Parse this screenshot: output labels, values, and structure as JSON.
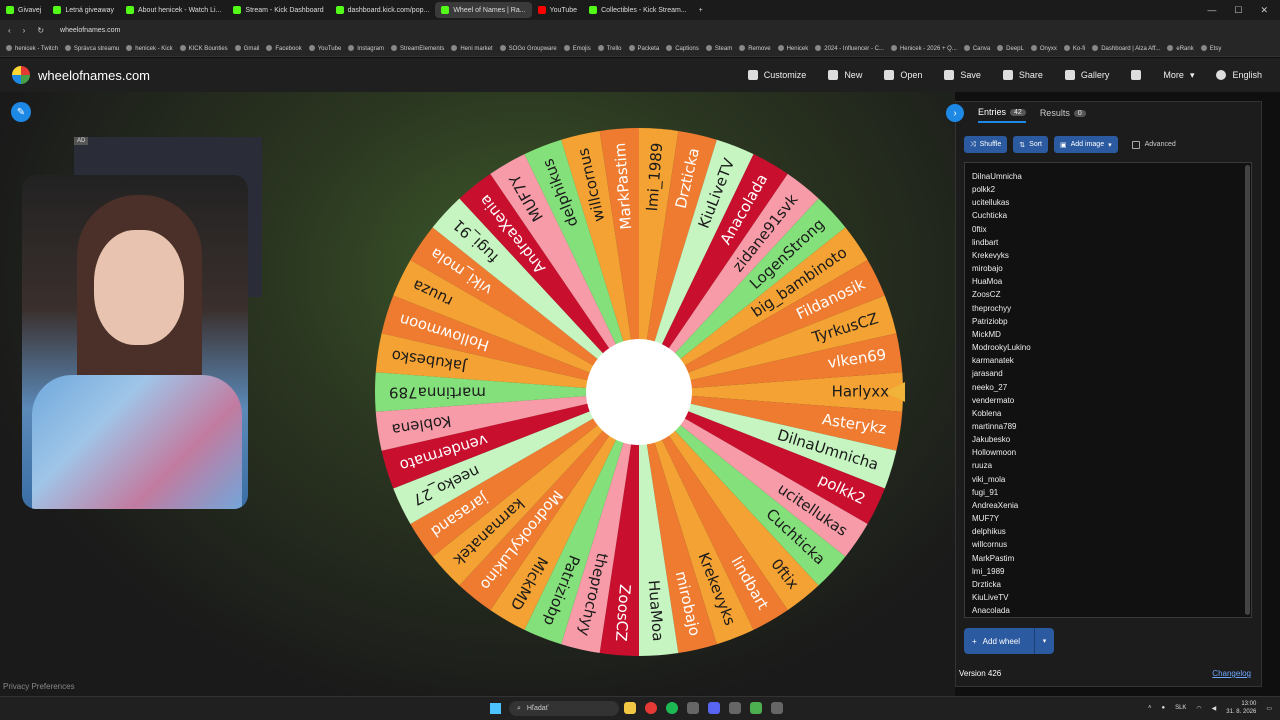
{
  "browser": {
    "tabs": [
      "Givavej",
      "Letná giveaway",
      "About henicek - Watch Li...",
      "Stream - Kick Dashboard",
      "dashboard.kick.com/pop...",
      "Wheel of Names | Ra...",
      "YouTube",
      "Collectibles - Kick Stream..."
    ],
    "url": "wheelofnames.com",
    "bookmarks": [
      "henicek - Twitch",
      "Správca streamu",
      "henicek - Kick",
      "KICK Bounties",
      "Gmail",
      "Facebook",
      "YouTube",
      "Instagram",
      "StreamElements",
      "Heni market",
      "SOGo Groupware",
      "Emojis",
      "Trello",
      "Packeta",
      "Captions",
      "Steam",
      "Remove",
      "Henicek",
      "2024 - Influencer - C...",
      "Henicek - 2026 + Q...",
      "Canva",
      "DeepL",
      "Onyxx",
      "Ko-fi",
      "Dashboard | Alza Aff...",
      "eRank",
      "Etsy"
    ]
  },
  "app": {
    "title": "wheelofnames.com",
    "menu": [
      "Customize",
      "New",
      "Open",
      "Save",
      "Share",
      "Gallery",
      "More",
      "English"
    ]
  },
  "ad_label": "AD",
  "privacy": "Privacy Preferences",
  "panel": {
    "entries_tab": "Entries",
    "entries_count": "42",
    "results_tab": "Results",
    "results_count": "0",
    "shuffle": "Shuffle",
    "sort": "Sort",
    "add_image": "Add image",
    "advanced": "Advanced",
    "entries": [
      "DilnaUmnicha",
      "polkk2",
      "ucitellukas",
      "Cuchticka",
      "0ftix",
      "lindbart",
      "Krekevyks",
      "mirobajo",
      "HuaMoa",
      "ZoosCZ",
      "theprochyy",
      "Patriziobp",
      "MickMD",
      "ModrookyLukino",
      "karmanatek",
      "jarasand",
      "neeko_27",
      "vendermato",
      "Koblena",
      "martinna789",
      "Jakubesko",
      "Hollowmoon",
      "ruuza",
      "viki_mola",
      "fugi_91",
      "AndreaXenia",
      "MUF7Y",
      "delphikus",
      "willcornus",
      "MarkPastim",
      "lmi_1989",
      "Drzticka",
      "KiuLiveTV",
      "Anacolada"
    ],
    "add_wheel": "Add wheel",
    "version": "Version 426",
    "changelog": "Changelog"
  },
  "wheel": {
    "slices": [
      "Harlyxx",
      "Asterykz",
      "DilnaUmnicha",
      "polkk2",
      "ucitellukas",
      "Cuchticka",
      "0ftix",
      "lindbart",
      "Krekevyks",
      "mirobajo",
      "HuaMoa",
      "ZoosCZ",
      "theprochyy",
      "Patriziobp",
      "MickMD",
      "ModrookyLukino",
      "karmanatek",
      "jarasand",
      "neeko_27",
      "vendermato",
      "Koblena",
      "martinna789",
      "Jakubesko",
      "Hollowmoon",
      "ruuza",
      "viki_mola",
      "fugi_91",
      "AndreaXenia",
      "MUF7Y",
      "delphikus",
      "willcornus",
      "MarkPastim",
      "lmi_1989",
      "Drzticka",
      "KiuLiveTV",
      "Anacolada",
      "zidane91svk",
      "LogenStrong",
      "big_bambinoto",
      "Fildanosik",
      "TyrkusCZ",
      "vlken69"
    ],
    "colors": [
      "#f4a233",
      "#ee7b30",
      "#c6f5c2",
      "#c8102e",
      "#f79ba8",
      "#83e07a",
      "#f4a233",
      "#ee7b30"
    ]
  },
  "taskbar": {
    "search": "Hľadať",
    "lang": "SLK",
    "time": "13:00",
    "date": "31. 8. 2026"
  }
}
